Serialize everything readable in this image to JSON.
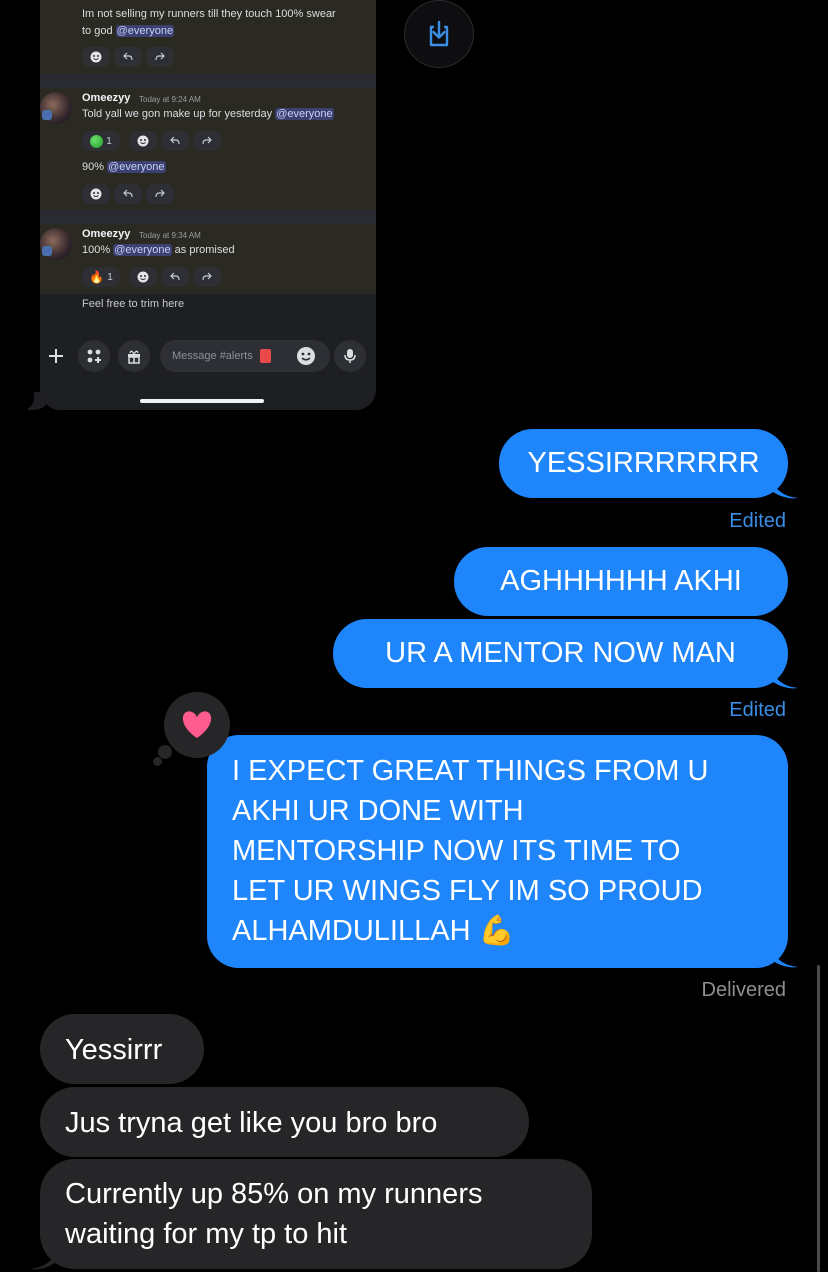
{
  "discord": {
    "msg1": {
      "line1": "Im not selling my runners till they touch 100% swear",
      "line2_prefix": "to god ",
      "mention": "@everyone"
    },
    "msg2": {
      "author": "Omeezyy",
      "time": "Today at 9:24 AM",
      "text_prefix": "Told yall we gon make up for yesterday ",
      "mention": "@everyone",
      "reaction_count": "1",
      "followup_prefix": "90% ",
      "followup_mention": "@everyone"
    },
    "msg3": {
      "author": "Omeezyy",
      "time": "Today at 9:34 AM",
      "text_prefix": "100% ",
      "mention": "@everyone",
      "text_suffix": " as promised",
      "reaction_count": "1",
      "followup": "Feel free to trim here"
    },
    "composer_placeholder": "Message #alerts"
  },
  "messages": {
    "out1": "YESSIRRRRRRR",
    "out1_status": "Edited",
    "out2": "AGHHHHHH AKHI",
    "out3": "UR A MENTOR NOW MAN",
    "out3_status": "Edited",
    "out4_lines": [
      "I EXPECT GREAT THINGS FROM U",
      "AKHI UR DONE WITH",
      "MENTORSHIP NOW ITS TIME TO",
      "LET UR WINGS FLY IM SO PROUD",
      "ALHAMDULILLAH 💪"
    ],
    "out4_status": "Delivered",
    "out4_tapback": "heart-icon",
    "in1": "Yessirrr",
    "in2": "Jus tryna get like you bro bro",
    "in3_lines": [
      "Currently up 85% on my runners",
      "waiting for my tp to hit"
    ]
  },
  "colors": {
    "outgoing": "#1f85fa",
    "incoming": "#262628",
    "status_edited": "#3a8ee6",
    "heart": "#ff5b8e"
  }
}
